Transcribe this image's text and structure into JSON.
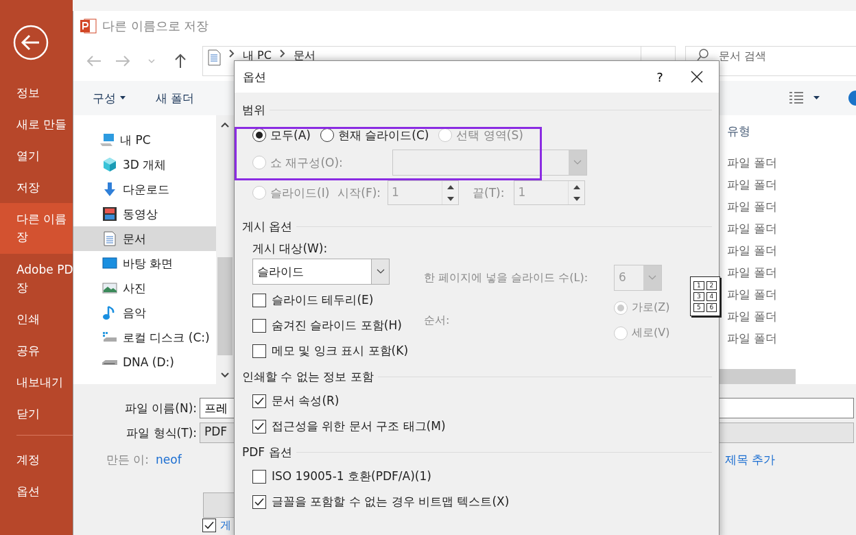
{
  "backstage": {
    "groups": [
      [
        {
          "lines": [
            "정보"
          ],
          "selected": false
        },
        {
          "lines": [
            "새로 만들"
          ],
          "selected": false
        },
        {
          "lines": [
            "열기"
          ],
          "selected": false
        },
        {
          "lines": [
            "저장"
          ],
          "selected": false
        },
        {
          "lines": [
            "다른 이름",
            "장"
          ],
          "selected": true
        },
        {
          "lines": [
            "Adobe PD",
            "장"
          ],
          "selected": false
        },
        {
          "lines": [
            "인쇄"
          ],
          "selected": false
        },
        {
          "lines": [
            "공유"
          ],
          "selected": false
        },
        {
          "lines": [
            "내보내기"
          ],
          "selected": false
        },
        {
          "lines": [
            "닫기"
          ],
          "selected": false
        }
      ],
      [
        {
          "lines": [
            "계정"
          ],
          "selected": false
        },
        {
          "lines": [
            "옵션"
          ],
          "selected": false
        }
      ]
    ]
  },
  "save_dialog": {
    "title": "다른 이름으로 저장",
    "breadcrumb": [
      "내 PC",
      "문서"
    ],
    "search": {
      "placeholder": "문서 검색"
    },
    "toolbar": {
      "organize": "구성",
      "new_folder": "새 폴더"
    },
    "tree": [
      {
        "label": "내 PC",
        "kind": "pc",
        "selected": false
      },
      {
        "label": "3D 개체",
        "kind": "cube",
        "selected": false
      },
      {
        "label": "다운로드",
        "kind": "download",
        "selected": false
      },
      {
        "label": "동영상",
        "kind": "video",
        "selected": false
      },
      {
        "label": "문서",
        "kind": "document",
        "selected": true
      },
      {
        "label": "바탕 화면",
        "kind": "desktop",
        "selected": false
      },
      {
        "label": "사진",
        "kind": "photo",
        "selected": false
      },
      {
        "label": "음악",
        "kind": "music",
        "selected": false
      },
      {
        "label": "로컬 디스크 (C:)",
        "kind": "system_drive",
        "selected": false
      },
      {
        "label": "DNA (D:)",
        "kind": "drive",
        "selected": false
      }
    ],
    "list": {
      "column": "유형",
      "rows": [
        "파일 폴더",
        "파일 폴더",
        "파일 폴더",
        "파일 폴더",
        "파일 폴더",
        "파일 폴더",
        "파일 폴더",
        "파일 폴더",
        "파일 폴더"
      ]
    },
    "filename": {
      "label": "파일 이름(N):",
      "value": "프레"
    },
    "filetype": {
      "label": "파일 형식(T):",
      "value": "PDF"
    },
    "author": {
      "label": "만든 이:",
      "value": "neof"
    },
    "title_link": "제목 추가",
    "option_checkbox": {
      "label": "게",
      "checked": true
    }
  },
  "options_dialog": {
    "title": "옵션",
    "help": "?",
    "range": {
      "title": "범위",
      "highlighted": true,
      "choices": [
        {
          "label": "모두(A)",
          "selected": true,
          "disabled": false
        },
        {
          "label": "현재 슬라이드(C)",
          "selected": false,
          "disabled": false
        },
        {
          "label": "선택 영역(S)",
          "selected": false,
          "disabled": true
        }
      ],
      "custom_show": {
        "label": "쇼 재구성(O):",
        "selected": false,
        "disabled": true
      },
      "slides": {
        "label": "슬라이드(I)",
        "selected": false,
        "disabled": true,
        "from_label": "시작(F):",
        "from": "1",
        "to_label": "끝(T):",
        "to": "1"
      }
    },
    "publish": {
      "title": "게시 옵션",
      "what_label": "게시 대상(W):",
      "what": "슬라이드",
      "checkboxes": [
        {
          "label": "슬라이드 테두리(E)",
          "checked": false
        },
        {
          "label": "숨겨진 슬라이드 포함(H)",
          "checked": false
        },
        {
          "label": "메모 및 잉크 표시 포함(K)",
          "checked": false
        }
      ],
      "per_page_label": "한 페이지에 넣을 슬라이드 수(L):",
      "per_page": "6",
      "order_label": "순서:",
      "order": [
        {
          "label": "가로(Z)",
          "selected": true,
          "disabled": true
        },
        {
          "label": "세로(V)",
          "selected": false,
          "disabled": true
        }
      ],
      "preview_numbers": [
        "1",
        "2",
        "3",
        "4",
        "5",
        "6"
      ]
    },
    "nonprint": {
      "title": "인쇄할 수 없는 정보 포함",
      "checkboxes": [
        {
          "label": "문서 속성(R)",
          "checked": true
        },
        {
          "label": "접근성을 위한 문서 구조 태그(M)",
          "checked": true
        }
      ]
    },
    "pdf": {
      "title": "PDF 옵션",
      "checkboxes": [
        {
          "label": "ISO 19005-1 호환(PDF/A)(1)",
          "checked": false
        },
        {
          "label": "글꼴을 포함할 수 없는 경우 비트맵 텍스트(X)",
          "checked": true
        }
      ]
    }
  }
}
